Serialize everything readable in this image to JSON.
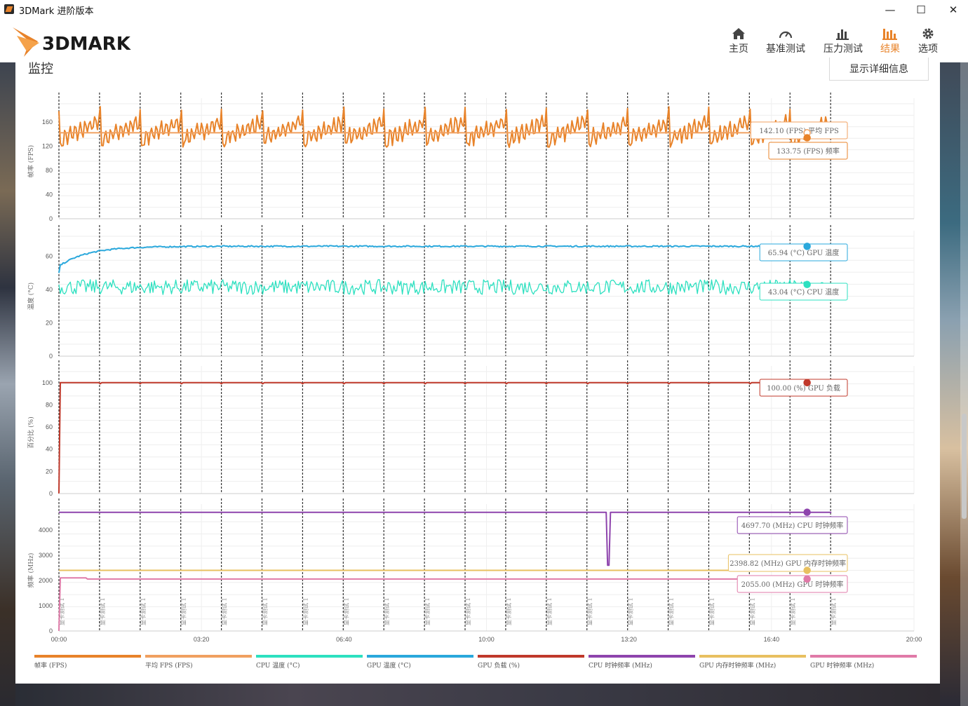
{
  "window": {
    "title": "3DMark 进阶版本",
    "controls": [
      "—",
      "☐",
      "✕"
    ]
  },
  "header": {
    "logo_text": "3DMARK",
    "nav": [
      {
        "label": "主页",
        "icon": "home-icon",
        "active": false
      },
      {
        "label": "基准测试",
        "icon": "gauge-icon",
        "active": false
      },
      {
        "label": "压力测试",
        "icon": "bar-chart-icon",
        "active": false
      },
      {
        "label": "结果",
        "icon": "results-icon",
        "active": true
      },
      {
        "label": "选项",
        "icon": "gear-icon",
        "active": false
      }
    ]
  },
  "accent_color": "#e8832a",
  "section": {
    "title": "监控",
    "detail_button": "显示详细信息"
  },
  "chart_data": {
    "type": "line",
    "x_axis": {
      "unit": "seconds",
      "range": [
        0,
        1200
      ],
      "ticks": [
        0,
        200,
        400,
        600,
        800,
        1000,
        1200
      ],
      "tick_labels": [
        "00:00",
        "03:20",
        "06:40",
        "10:00",
        "13:20",
        "16:40",
        "20:00"
      ]
    },
    "loops": {
      "count": 20,
      "label": "显卡测试 1",
      "start": 0,
      "period": 57
    },
    "charts": [
      {
        "ylabel": "帧率 (FPS)",
        "ylim": [
          0,
          190
        ],
        "yticks": [
          0,
          40,
          80,
          120,
          160
        ],
        "series": [
          {
            "name": "帧率 (FPS)",
            "color": "#e8832a",
            "pattern": "fps",
            "end_value": 133.75
          },
          {
            "name": "平均 FPS (FPS)",
            "color": "#f0a060",
            "constant": 142.1
          }
        ],
        "tooltips": [
          {
            "text": "142.10 (FPS) 平均 FPS",
            "value": 142.1,
            "color": "#f0a060",
            "hollow": true
          },
          {
            "text": "133.75 (FPS) 频率",
            "value": 133.75,
            "color": "#e8832a",
            "hollow": false
          }
        ]
      },
      {
        "ylabel": "温度 (°C)",
        "ylim": [
          0,
          72
        ],
        "yticks": [
          0,
          20,
          40,
          60
        ],
        "series": [
          {
            "name": "GPU 温度 (°C)",
            "color": "#2aa8dc",
            "pattern": "gpu_temp",
            "end_value": 65.94
          },
          {
            "name": "CPU 温度 (°C)",
            "color": "#2de0c0",
            "pattern": "cpu_temp",
            "end_value": 43.04
          }
        ],
        "tooltips": [
          {
            "text": "65.94 (°C) GPU 温度",
            "value": 65.94,
            "color": "#2aa8dc",
            "hollow": false
          },
          {
            "text": "43.04 (°C) CPU 温度",
            "value": 43.04,
            "color": "#2de0c0",
            "hollow": false
          }
        ]
      },
      {
        "ylabel": "百分比 (%)",
        "ylim": [
          0,
          110
        ],
        "yticks": [
          0,
          20,
          40,
          60,
          80,
          100
        ],
        "series": [
          {
            "name": "GPU 负载 (%)",
            "color": "#c0392b",
            "pattern": "gpu_load",
            "end_value": 100.0
          }
        ],
        "tooltips": [
          {
            "text": "100.00 (%) GPU 负载",
            "value": 100.0,
            "color": "#c0392b",
            "hollow": false
          }
        ]
      },
      {
        "ylabel": "频率 (MHz)",
        "ylim": [
          0,
          4800
        ],
        "yticks": [
          0,
          1000,
          2000,
          3000,
          4000
        ],
        "series": [
          {
            "name": "CPU 时钟频率 (MHz)",
            "color": "#8e44ad",
            "pattern": "cpu_clock",
            "end_value": 4697.7
          },
          {
            "name": "GPU 内存时钟频率 (MHz)",
            "color": "#e8c060",
            "constant": 2398.82
          },
          {
            "name": "GPU 时钟频率 (MHz)",
            "color": "#e07aa8",
            "pattern": "gpu_clock",
            "end_value": 2055.0
          }
        ],
        "tooltips": [
          {
            "text": "4697.70 (MHz) CPU 时钟频率",
            "value": 4697.7,
            "color": "#8e44ad",
            "hollow": false
          },
          {
            "text": "2398.82 (MHz) GPU 内存时钟频率",
            "value": 2398.82,
            "color": "#e8c060",
            "hollow": false
          },
          {
            "text": "2055.00 (MHz) GPU 时钟频率",
            "value": 2055.0,
            "color": "#e07aa8",
            "hollow": false
          }
        ]
      }
    ],
    "legend": [
      {
        "label": "帧率 (FPS)",
        "color": "#e8832a"
      },
      {
        "label": "平均 FPS (FPS)",
        "color": "#f0a060"
      },
      {
        "label": "CPU 温度 (°C)",
        "color": "#2de0c0"
      },
      {
        "label": "GPU 温度 (°C)",
        "color": "#2aa8dc"
      },
      {
        "label": "GPU 负载 (%)",
        "color": "#c0392b"
      },
      {
        "label": "CPU 时钟频率 (MHz)",
        "color": "#8e44ad"
      },
      {
        "label": "GPU 内存时钟频率 (MHz)",
        "color": "#e8c060"
      },
      {
        "label": "GPU 时钟频率 (MHz)",
        "color": "#e07aa8"
      }
    ]
  }
}
